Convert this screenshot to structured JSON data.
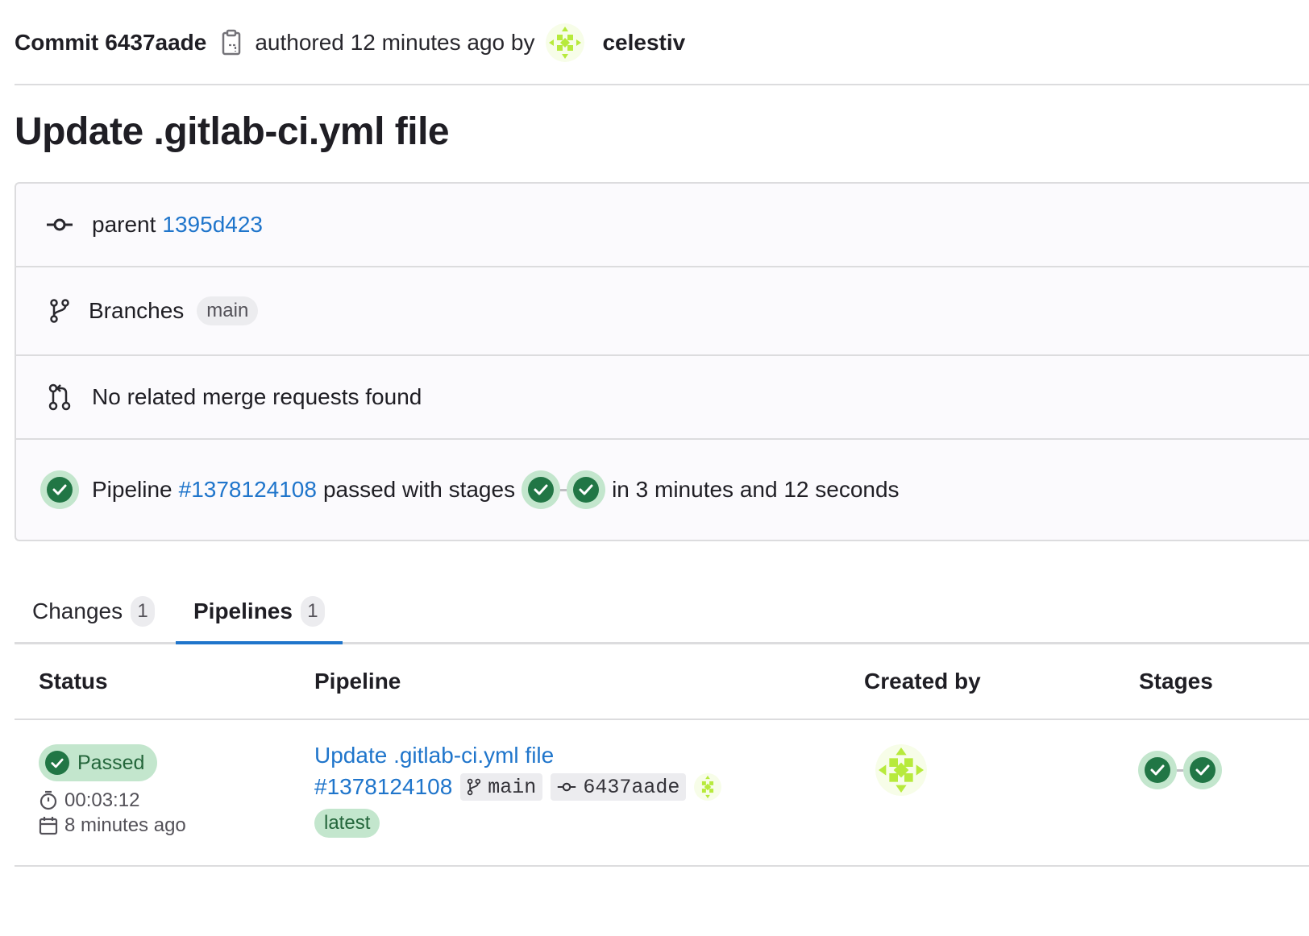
{
  "header": {
    "commit_label": "Commit",
    "commit_sha": "6437aade",
    "authored_text": "authored 12 minutes ago by",
    "author_name": "celestiv"
  },
  "title": "Update .gitlab-ci.yml file",
  "info": {
    "parent_label": "parent",
    "parent_sha": "1395d423",
    "branches_label": "Branches",
    "branch_name": "main",
    "mr_text": "No related merge requests found",
    "pipeline_prefix": "Pipeline",
    "pipeline_id": "#1378124108",
    "pipeline_mid": "passed with stages",
    "pipeline_suffix": "in 3 minutes and 12 seconds"
  },
  "tabs": [
    {
      "label": "Changes",
      "count": "1"
    },
    {
      "label": "Pipelines",
      "count": "1"
    }
  ],
  "table": {
    "headers": [
      "Status",
      "Pipeline",
      "Created by",
      "Stages"
    ],
    "row": {
      "status": "Passed",
      "duration": "00:03:12",
      "finished": "8 minutes ago",
      "pipeline_title": "Update .gitlab-ci.yml file",
      "pipeline_id": "#1378124108",
      "branch": "main",
      "sha": "6437aade",
      "badge": "latest"
    }
  },
  "colors": {
    "link": "#1f75cb",
    "success": "#217645",
    "success_bg": "#c3e6cd",
    "border": "#dcdcde"
  }
}
